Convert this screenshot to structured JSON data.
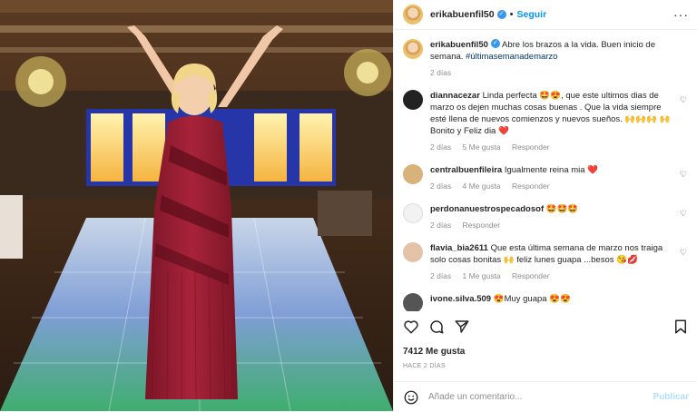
{
  "post": {
    "username": "erikabuenfil50",
    "follow_label": "Seguir",
    "caption": "Abre los brazos a la vida. Buen inicio de semana.",
    "hashtag": "#últimasemanademarzo",
    "caption_time": "2 días",
    "likes": "7412 Me gusta",
    "posted_ago": "HACE 2 DÍAS",
    "comment_placeholder": "Añade un comentario...",
    "publish_label": "Publicar"
  },
  "comments": [
    {
      "user": "diannacezar",
      "text": "Linda perfecta 🤩😍, que este ultimos dias de marzo os dejen muchas cosas buenas . Que la vida siempre esté llena de nuevos comienzos y nuevos sueños. 🙌🙌🙌 🙌 Bonito y Feliz dia ❤️",
      "time": "2 días",
      "likes": "5 Me gusta",
      "reply": "Responder"
    },
    {
      "user": "centralbuenfileira",
      "text": "Igualmente reina mia ❤️",
      "time": "2 días",
      "likes": "4 Me gusta",
      "reply": "Responder"
    },
    {
      "user": "perdonanuestrospecadosof",
      "text": "🤩🤩🤩",
      "time": "2 días",
      "likes": "",
      "reply": "Responder"
    },
    {
      "user": "flavia_bia2611",
      "text": "Que esta última semana de marzo nos traiga solo cosas bonitas 🙌 feliz lunes guapa ...besos 😘💋",
      "time": "2 días",
      "likes": "1 Me gusta",
      "reply": "Responder"
    },
    {
      "user": "ivone.silva.509",
      "text": "😍Muy guapa 😍😍",
      "time": "",
      "likes": "",
      "reply": ""
    }
  ],
  "colors": {
    "accent": "#0095f6",
    "verified": "#3897f0",
    "dress": "#9c1f33"
  }
}
